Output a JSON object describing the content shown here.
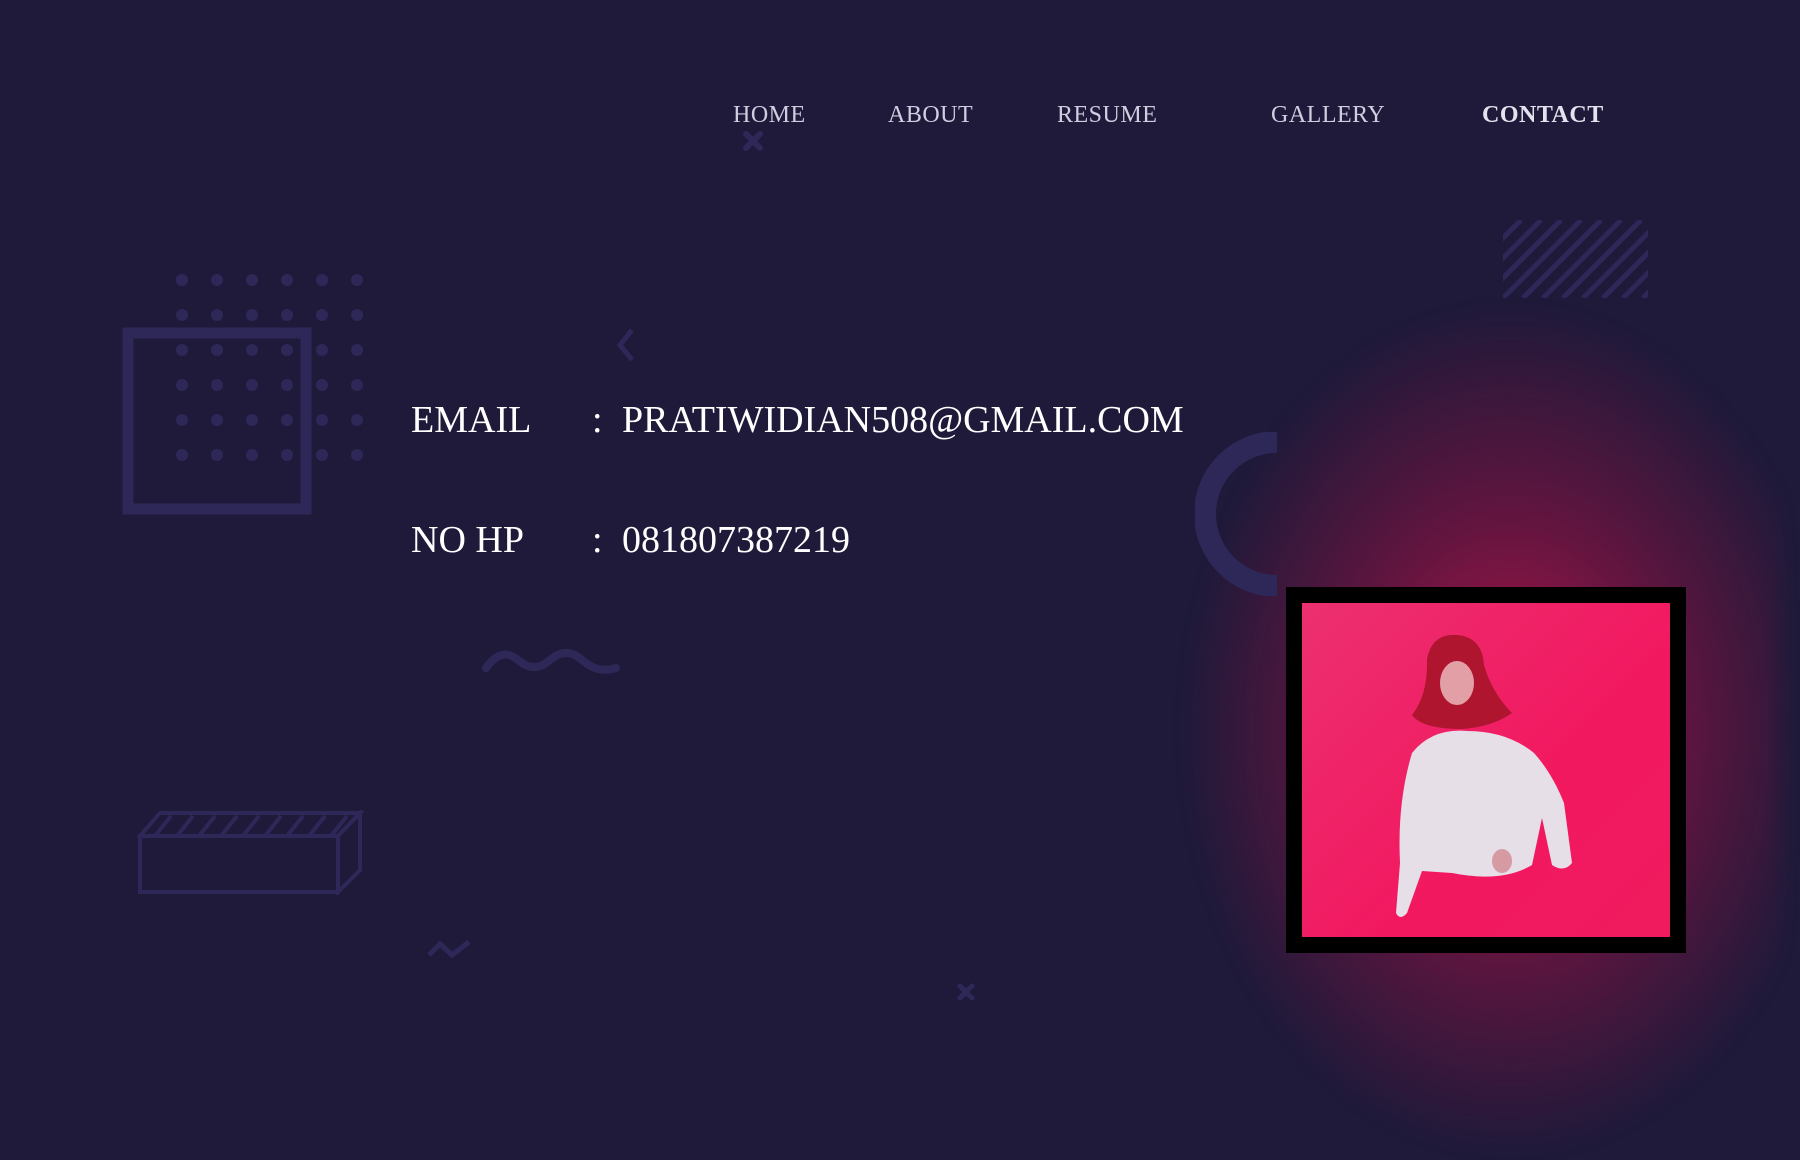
{
  "nav": {
    "items": [
      {
        "label": "HOME",
        "active": false
      },
      {
        "label": "ABOUT",
        "active": false
      },
      {
        "label": "RESUME",
        "active": false
      },
      {
        "label": "GALLERY",
        "active": false
      },
      {
        "label": "CONTACT",
        "active": true
      }
    ]
  },
  "contact": {
    "email": {
      "label": "EMAIL",
      "separator": ":",
      "value": "PRATIWIDIAN508@GMAIL.COM"
    },
    "phone": {
      "label": "NO HP",
      "separator": ":",
      "value": "081807387219"
    }
  },
  "photo": {
    "icon": "profile-photo",
    "background_color": "#f21860"
  },
  "colors": {
    "background": "#1f1a3a",
    "accent": "#f21860",
    "decor": "#2e2858"
  }
}
